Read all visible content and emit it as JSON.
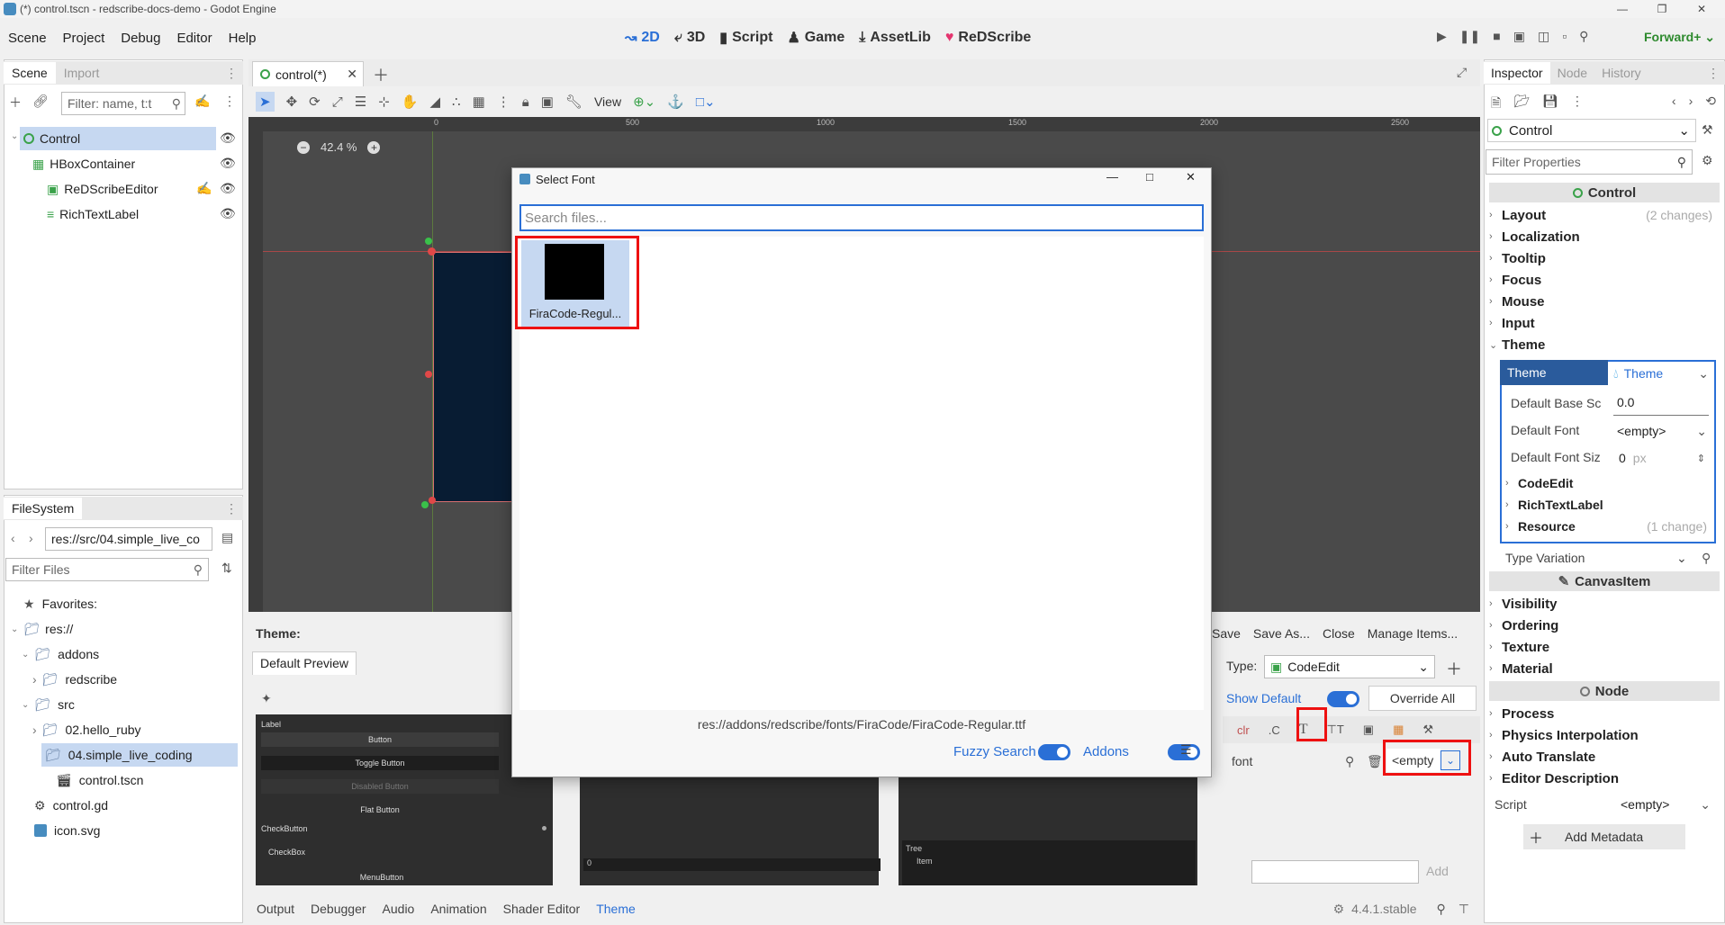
{
  "window": {
    "title": "(*) control.tscn - redscribe-docs-demo - Godot Engine"
  },
  "menu": [
    "Scene",
    "Project",
    "Debug",
    "Editor",
    "Help"
  ],
  "workspaces": [
    {
      "label": "2D",
      "icon": "2d-icon",
      "active": true
    },
    {
      "label": "3D",
      "icon": "3d-icon",
      "active": false
    },
    {
      "label": "Script",
      "icon": "script-icon",
      "active": false
    },
    {
      "label": "Game",
      "icon": "game-icon",
      "active": false
    },
    {
      "label": "AssetLib",
      "icon": "assetlib-icon",
      "active": false
    },
    {
      "label": "ReDScribe",
      "icon": "heart-icon",
      "active": false
    }
  ],
  "renderer": "Forward+",
  "scene_dock": {
    "tabs": [
      "Scene",
      "Import"
    ],
    "filter_placeholder": "Filter: name, t:t",
    "nodes": [
      "Control",
      "HBoxContainer",
      "ReDScribeEditor",
      "RichTextLabel"
    ]
  },
  "filesystem_dock": {
    "tab": "FileSystem",
    "path": "res://src/04.simple_live_co",
    "filter_placeholder": "Filter Files",
    "items": [
      "Favorites:",
      "res://",
      "addons",
      "redscribe",
      "src",
      "02.hello_ruby",
      "04.simple_live_coding",
      "control.tscn",
      "control.gd",
      "icon.svg"
    ]
  },
  "scene_tab": {
    "label": "control(*)"
  },
  "toolbar": {
    "view_label": "View",
    "zoom": "42.4 %"
  },
  "ruler": [
    "0",
    "500",
    "1000",
    "1500",
    "2000",
    "2500"
  ],
  "dialog": {
    "title": "Select Font",
    "search_placeholder": "Search files...",
    "file_name": "FiraCode-Regul...",
    "selected_path": "res://addons/redscribe/fonts/FiraCode/FiraCode-Regular.ttf",
    "fuzzy_label": "Fuzzy Search",
    "addons_label": "Addons"
  },
  "theme_panel": {
    "title": "Theme:",
    "preview_tab": "Default Preview",
    "actions": [
      "Save",
      "Save As...",
      "Close",
      "Manage Items..."
    ],
    "type_label": "Type:",
    "type_value": "CodeEdit",
    "show_default": "Show Default",
    "override_all": "Override All",
    "font_label": "font",
    "font_value": "<empty",
    "add_label": "Add",
    "preview_items": [
      "Label",
      "Button",
      "Toggle Button",
      "Disabled Button",
      "Flat Button",
      "CheckButton",
      "CheckBox",
      "MenuButton"
    ],
    "spin_value": "0",
    "tree_items": [
      "Tree",
      "Item"
    ]
  },
  "bottom_bar": {
    "tabs": [
      "Output",
      "Debugger",
      "Audio",
      "Animation",
      "Shader Editor",
      "Theme"
    ],
    "version": "4.4.1.stable"
  },
  "inspector": {
    "tabs": [
      "Inspector",
      "Node",
      "History"
    ],
    "object": "Control",
    "filter_placeholder": "Filter Properties",
    "section_control": "Control",
    "groups": [
      {
        "label": "Layout",
        "note": "(2 changes)"
      },
      {
        "label": "Localization",
        "note": ""
      },
      {
        "label": "Tooltip",
        "note": ""
      },
      {
        "label": "Focus",
        "note": ""
      },
      {
        "label": "Mouse",
        "note": ""
      },
      {
        "label": "Input",
        "note": ""
      },
      {
        "label": "Theme",
        "note": ""
      }
    ],
    "theme_prop": "Theme",
    "theme_value": "Theme",
    "sub_props": [
      {
        "label": "Default Base Sc",
        "value": "0.0"
      },
      {
        "label": "Default Font",
        "value": "<empty>"
      },
      {
        "label": "Default Font Siz",
        "value": "0",
        "unit": "px"
      }
    ],
    "sub_groups": [
      {
        "label": "CodeEdit",
        "note": ""
      },
      {
        "label": "RichTextLabel",
        "note": ""
      },
      {
        "label": "Resource",
        "note": "(1 change)"
      }
    ],
    "type_variation": "Type Variation",
    "section_canvas": "CanvasItem",
    "canvas_groups": [
      "Visibility",
      "Ordering",
      "Texture",
      "Material"
    ],
    "section_node": "Node",
    "node_groups": [
      "Process",
      "Physics Interpolation",
      "Auto Translate",
      "Editor Description"
    ],
    "script_label": "Script",
    "script_value": "<empty>",
    "add_metadata": "Add Metadata"
  }
}
